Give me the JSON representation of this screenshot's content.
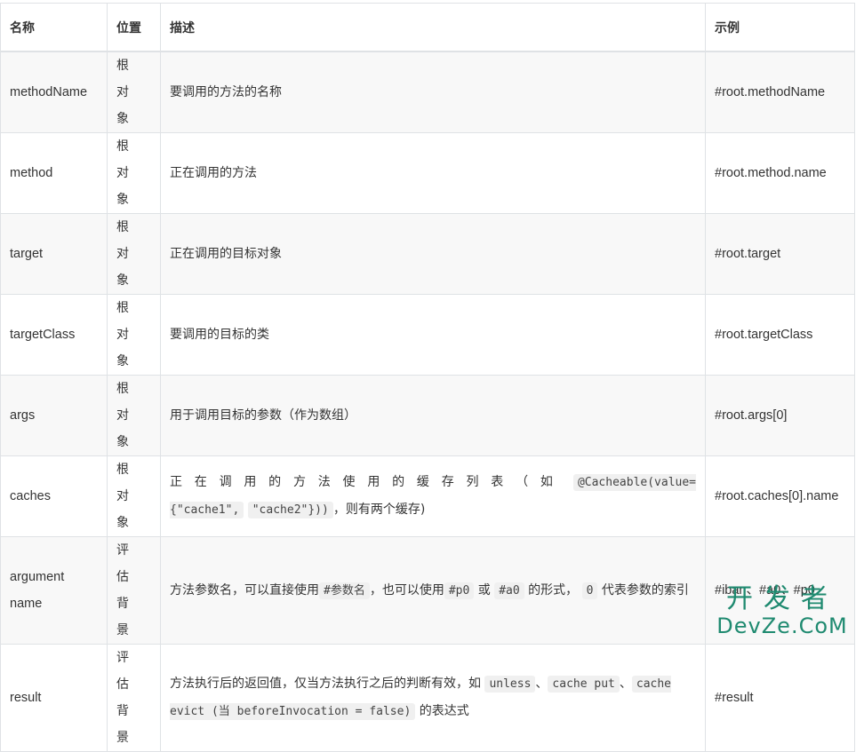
{
  "table": {
    "headers": {
      "name": "名称",
      "position": "位置",
      "description": "描述",
      "example": "示例"
    },
    "rows": [
      {
        "name": "methodName",
        "position": "根对象",
        "description": "要调用的方法的名称",
        "example": "#root.methodName"
      },
      {
        "name": "method",
        "position": "根对象",
        "description": "正在调用的方法",
        "example": "#root.method.name"
      },
      {
        "name": "target",
        "position": "根对象",
        "description": "正在调用的目标对象",
        "example": "#root.target"
      },
      {
        "name": "targetClass",
        "position": "根对象",
        "description": "要调用的目标的类",
        "example": "#root.targetClass"
      },
      {
        "name": "args",
        "position": "根对象",
        "description": "用于调用目标的参数（作为数组）",
        "example": "#root.args[0]"
      },
      {
        "name": "caches",
        "position": "根对象",
        "description_parts": {
          "prefix": "正在调用的方法使用的缓存列表（如",
          "code1": "@Cacheable(value={\"cache1\",",
          "code2": "\"cache2\"}))",
          "suffix": "，则有两个缓存)"
        },
        "example": "#root.caches[0].name"
      },
      {
        "name": "argument name",
        "position": "评估背景",
        "description_parts": {
          "t1": "方法参数名，可以直接使用",
          "c1": "#参数名",
          "t2": "，也可以使用",
          "c2": "#p0",
          "t3": "或",
          "c3": "#a0",
          "t4": "的形式，",
          "c4": "0",
          "t5": "代表参数的索引"
        },
        "example": "#iban、#a0、#p0"
      },
      {
        "name": "result",
        "position": "评估背景",
        "description_parts": {
          "t1": "方法执行后的返回值，仅当方法执行之后的判断有效，如",
          "c1": "unless",
          "t2": "、",
          "c2": "cache put",
          "t3": "、",
          "c3": "cache evict (当 beforeInvocation = false)",
          "t4": "的表达式"
        },
        "example": "#result"
      }
    ]
  },
  "watermark": {
    "line1": "开发者",
    "line2": "DevZe.CoM"
  }
}
